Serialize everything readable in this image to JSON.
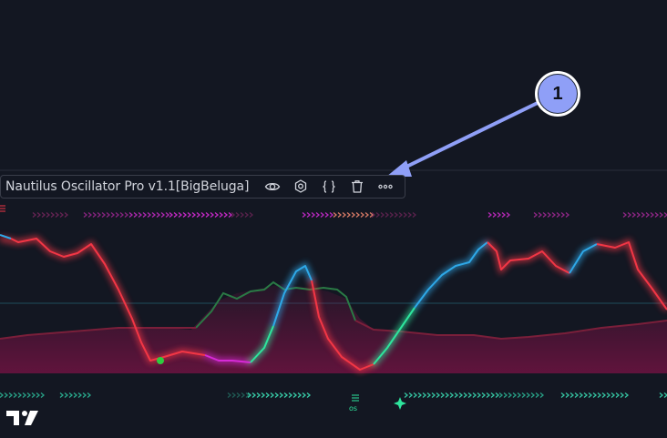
{
  "indicator": {
    "title": "Nautilus Oscillator Pro v1.1[BigBeluga]",
    "buttons": [
      "eye-icon",
      "gear-icon",
      "braces-icon",
      "trash-icon",
      "more-icon"
    ]
  },
  "annotation": {
    "number": "1"
  },
  "signals": {
    "oversold_label": "os"
  },
  "colors": {
    "background": "#131722",
    "bearish_line": "#f23645",
    "bullish_line": "#2ea8e8",
    "rising_line": "#2ee59d",
    "oversold_line": "#d62ad6",
    "signal_green": "#2a7a45",
    "zone_fill": "#7a1245",
    "badge": "#8f9ff7",
    "arrow": "#8f9ff7"
  }
}
